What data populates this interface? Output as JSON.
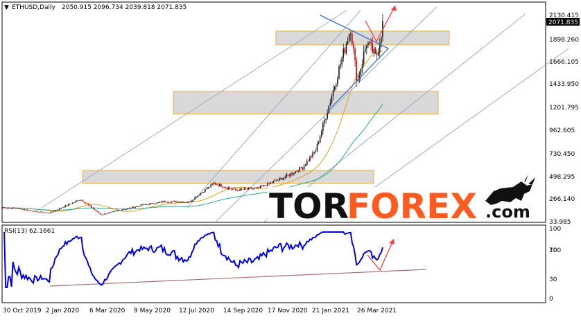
{
  "header": {
    "symbol": "ETHUSD,Daily",
    "ohlc": "2050.915 2096.734 2039.818 2071.835"
  },
  "price_axis": {
    "ticks": [
      "2130.415",
      "1898.260",
      "1666.105",
      "1433.950",
      "1201.795",
      "962.605",
      "730.450",
      "498.295",
      "266.140",
      "33.985"
    ],
    "current_price": "2071.835"
  },
  "rsi_panel": {
    "label": "RSI(13) 62.1661",
    "ticks": [
      "100",
      "70",
      "30",
      "0"
    ]
  },
  "time_axis": {
    "ticks": [
      "30 Oct 2019",
      "2 Jan 2020",
      "6 Mar 2020",
      "9 May 2020",
      "12 Jul 2020",
      "14 Sep 2020",
      "17 Nov 2020",
      "21 Jan 2021",
      "26 Mar 2021"
    ]
  },
  "logo": {
    "part1": "TOR",
    "part2": "FOREX",
    "suffix": ".com",
    "color_dark": "#111111",
    "color_accent": "#ff5a1f"
  },
  "colors": {
    "candle_bull": "#1a1a1a",
    "candle_bear": "#cc0000",
    "ma_fast": "#d9a21b",
    "ma_slow": "#26a69a",
    "rsi_line": "#0000ee",
    "trend_line": "#9aaebd",
    "arrow": "#ff3b3b",
    "wedge": "#3a6fd8",
    "zone_fill": "#d9d9d9",
    "zone_border": "#e5b04a",
    "rsi_support": "#a0706e"
  },
  "chart_data": {
    "type": "candlestick",
    "instrument": "ETHUSD",
    "timeframe": "Daily",
    "ylim": [
      33.985,
      2130.415
    ],
    "rsi_range": [
      0,
      100
    ],
    "rsi_levels": [
      30,
      70
    ],
    "x_dates": [
      "2019-10-30",
      "2020-01-02",
      "2020-03-06",
      "2020-05-09",
      "2020-07-12",
      "2020-09-14",
      "2020-11-17",
      "2021-01-21",
      "2021-03-26"
    ],
    "close_series": [
      {
        "date": "2019-10-30",
        "close": 184
      },
      {
        "date": "2019-11-20",
        "close": 175
      },
      {
        "date": "2019-12-15",
        "close": 142
      },
      {
        "date": "2020-01-02",
        "close": 128
      },
      {
        "date": "2020-02-14",
        "close": 268
      },
      {
        "date": "2020-03-13",
        "close": 110
      },
      {
        "date": "2020-04-10",
        "close": 160
      },
      {
        "date": "2020-05-09",
        "close": 210
      },
      {
        "date": "2020-06-10",
        "close": 245
      },
      {
        "date": "2020-07-12",
        "close": 240
      },
      {
        "date": "2020-08-15",
        "close": 430
      },
      {
        "date": "2020-09-14",
        "close": 360
      },
      {
        "date": "2020-10-15",
        "close": 380
      },
      {
        "date": "2020-11-17",
        "close": 480
      },
      {
        "date": "2020-12-15",
        "close": 590
      },
      {
        "date": "2021-01-02",
        "close": 760
      },
      {
        "date": "2021-01-21",
        "close": 1240
      },
      {
        "date": "2021-02-19",
        "close": 2010
      },
      {
        "date": "2021-02-28",
        "close": 1450
      },
      {
        "date": "2021-03-13",
        "close": 1860
      },
      {
        "date": "2021-03-26",
        "close": 1700
      },
      {
        "date": "2021-04-05",
        "close": 2071.835
      }
    ],
    "zones": [
      {
        "low": 430,
        "high": 560
      },
      {
        "low": 1130,
        "high": 1360
      },
      {
        "low": 1830,
        "high": 1970
      }
    ]
  }
}
